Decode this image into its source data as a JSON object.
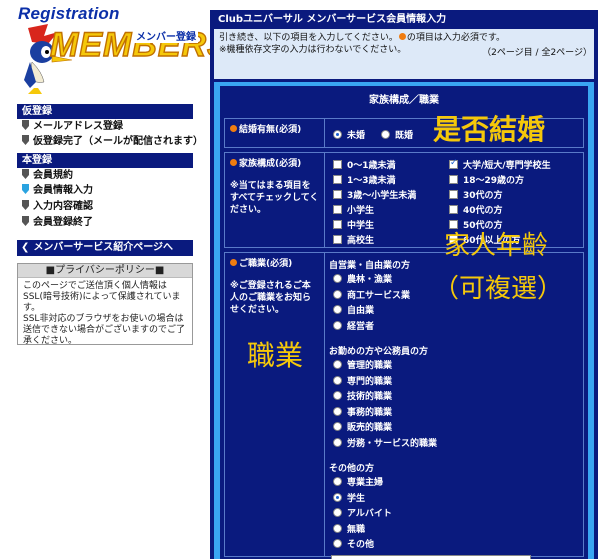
{
  "logo": {
    "title": "Registration",
    "sub": "メンバー登録",
    "wordmark": "MEMBERS"
  },
  "sidebar": {
    "sections": [
      {
        "title": "仮登録",
        "items": [
          "メールアドレス登録",
          "仮登録完了（メールが配信されます）"
        ]
      },
      {
        "title": "本登録",
        "items": [
          "会員規約",
          "会員情報入力",
          "入力内容確認",
          "会員登録終了"
        ]
      }
    ],
    "intro_link": "メンバーサービス紹介ページへ",
    "privacy": {
      "title": "■プライバシーポリシー■",
      "text": "このページでご送信頂く個人情報はSSL(暗号技術)によって保護されています。\nSSL非対応のブラウザをお使いの場合は送信できない場合がございますのでご了承ください。"
    }
  },
  "main": {
    "title": "Clubユニバーサル メンバーサービス会員情報入力",
    "notice_a": "引き続き、以下の項目を入力してください。",
    "notice_b": "の項目は入力必須です。",
    "notice_c": "※機種依存文字の入力は行わないでください。",
    "pager": "（2ページ目 / 全2ページ）",
    "form_heading": "家族構成／職業",
    "marital": {
      "label": "結婚有無(必須)",
      "options": [
        {
          "label": "未婚",
          "selected": true
        },
        {
          "label": "既婚",
          "selected": false
        }
      ]
    },
    "family": {
      "label": "家族構成(必須)",
      "note": "※当てはまる項目をすべてチェックしてください。",
      "options": [
        {
          "label": "0〜1歳未満",
          "checked": false
        },
        {
          "label": "大学/短大/専門学校生",
          "checked": true
        },
        {
          "label": "1〜3歳未満",
          "checked": false
        },
        {
          "label": "18〜29歳の方",
          "checked": false
        },
        {
          "label": "3歳〜小学生未満",
          "checked": false
        },
        {
          "label": "30代の方",
          "checked": false
        },
        {
          "label": "小学生",
          "checked": false
        },
        {
          "label": "40代の方",
          "checked": false
        },
        {
          "label": "中学生",
          "checked": false
        },
        {
          "label": "50代の方",
          "checked": false
        },
        {
          "label": "高校生",
          "checked": false
        },
        {
          "label": "60代以上の方",
          "checked": false
        }
      ]
    },
    "job": {
      "label": "ご職業(必須)",
      "note": "※ご登録されるご本人のご職業をお知らせください。",
      "groups": [
        {
          "title": "自営業・自由業の方",
          "options": [
            "農林・漁業",
            "商工サービス業",
            "自由業",
            "経営者"
          ]
        },
        {
          "title": "お勤めの方や公務員の方",
          "options": [
            "管理的職業",
            "専門的職業",
            "技術的職業",
            "事務的職業",
            "販売的職業",
            "労務・サービス的職業"
          ]
        },
        {
          "title": "その他の方",
          "options": [
            "専業主婦",
            "学生",
            "アルバイト",
            "無職",
            "その他"
          ]
        }
      ],
      "selected": "学生"
    }
  },
  "annotations": {
    "married": "是否結婚",
    "family_age": "家人年齡",
    "multi": "（可複選）",
    "job": "職業"
  },
  "colors": {
    "panel": "#0a1a7e",
    "frame": "#3aa6f2",
    "notice_bg": "#dde9f8",
    "required_dot": "#f07c10",
    "annotation": "#f5c80a"
  }
}
